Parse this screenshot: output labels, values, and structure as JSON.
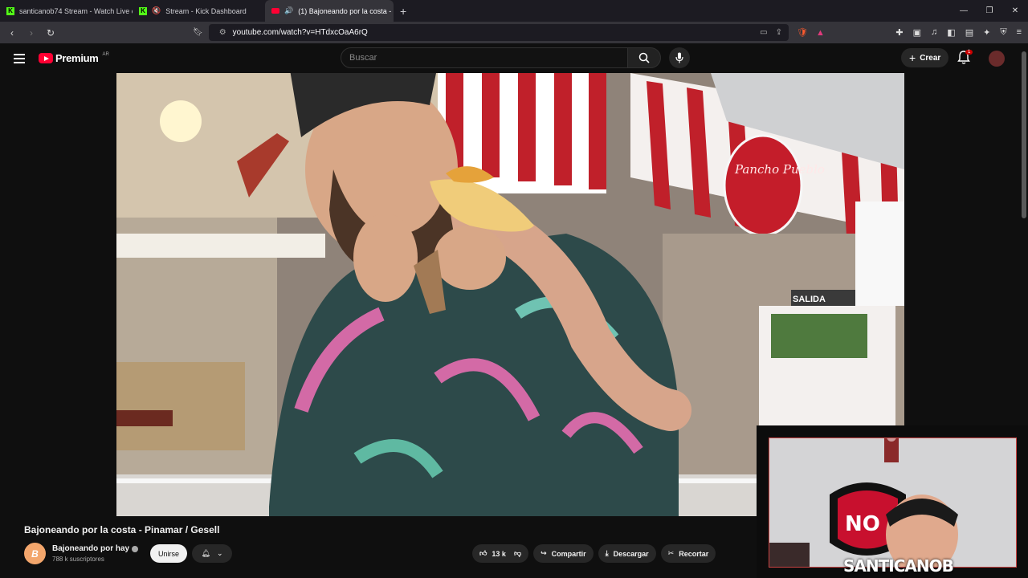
{
  "browser": {
    "tabs": [
      {
        "label": "santicanob74 Stream - Watch Live on"
      },
      {
        "label": "Stream - Kick Dashboard"
      },
      {
        "label": "(1) Bajoneando por la costa -"
      }
    ],
    "url": "youtube.com/watch?v=HTdxcOaA6rQ"
  },
  "youtube": {
    "logo": "Premium",
    "country": "AR",
    "search_placeholder": "Buscar",
    "create_label": "Crear",
    "notif_count": "1"
  },
  "video": {
    "title": "Bajoneando por la costa - Pinamar / Gesell",
    "channel": "Bajoneando por hay",
    "channel_initial": "B",
    "subscribers": "788 k suscriptores",
    "join_label": "Unirse",
    "likes": "13 k",
    "share_label": "Compartir",
    "download_label": "Descargar",
    "clip_label": "Recortar"
  },
  "scene": {
    "shop_sign": "Pancho Pueblo",
    "exit_sign": "SALIDA"
  },
  "overlay": {
    "streamer": "SANTICANOB",
    "shield_text": "NO"
  },
  "colors": {
    "accent": "#ff0033",
    "kick": "#53fc18"
  }
}
